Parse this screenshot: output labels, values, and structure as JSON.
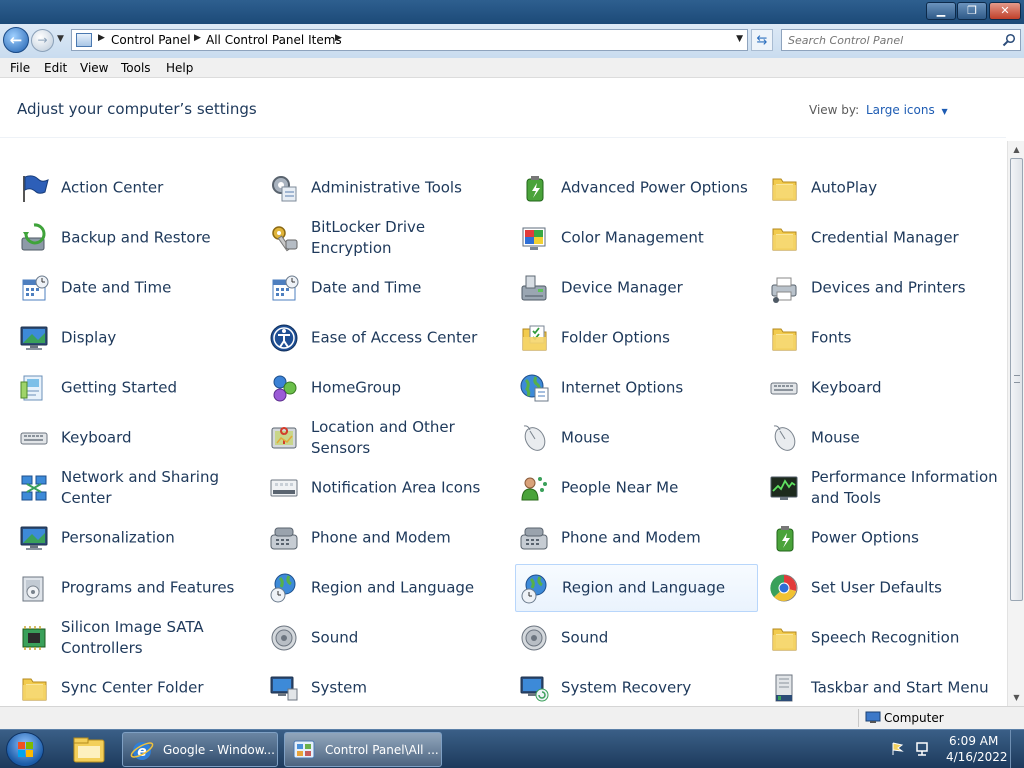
{
  "window": {
    "caption_buttons": {
      "minimize": "▁",
      "maximize": "❐",
      "close": "✕"
    }
  },
  "address_bar": {
    "breadcrumbs": [
      "Control Panel",
      "All Control Panel Items"
    ]
  },
  "search": {
    "placeholder": "Search Control Panel"
  },
  "menu": [
    "File",
    "Edit",
    "View",
    "Tools",
    "Help"
  ],
  "content": {
    "heading": "Adjust your computer’s settings",
    "view_by_label": "View by:",
    "view_by_value": "Large icons"
  },
  "items": [
    {
      "label": "Action Center",
      "icon": "flag-icon"
    },
    {
      "label": "Administrative Tools",
      "icon": "admin-tools-icon"
    },
    {
      "label": "Advanced Power Options",
      "icon": "battery-icon"
    },
    {
      "label": "AutoPlay",
      "icon": "folder-icon"
    },
    {
      "label": "Backup and Restore",
      "icon": "backup-icon"
    },
    {
      "label": "BitLocker Drive Encryption",
      "icon": "key-icon"
    },
    {
      "label": "Color Management",
      "icon": "color-icon"
    },
    {
      "label": "Credential Manager",
      "icon": "folder-icon"
    },
    {
      "label": "Date and Time",
      "icon": "calendar-icon"
    },
    {
      "label": "Date and Time",
      "icon": "calendar-icon"
    },
    {
      "label": "Device Manager",
      "icon": "device-manager-icon"
    },
    {
      "label": "Devices and Printers",
      "icon": "printer-icon"
    },
    {
      "label": "Display",
      "icon": "monitor-icon"
    },
    {
      "label": "Ease of Access Center",
      "icon": "accessibility-icon"
    },
    {
      "label": "Folder Options",
      "icon": "folder-options-icon"
    },
    {
      "label": "Fonts",
      "icon": "folder-icon"
    },
    {
      "label": "Getting Started",
      "icon": "getting-started-icon"
    },
    {
      "label": "HomeGroup",
      "icon": "homegroup-icon"
    },
    {
      "label": "Internet Options",
      "icon": "globe-icon"
    },
    {
      "label": "Keyboard",
      "icon": "keyboard-icon"
    },
    {
      "label": "Keyboard",
      "icon": "keyboard-icon"
    },
    {
      "label": "Location and Other Sensors",
      "icon": "location-icon"
    },
    {
      "label": "Mouse",
      "icon": "mouse-icon"
    },
    {
      "label": "Mouse",
      "icon": "mouse-icon"
    },
    {
      "label": "Network and Sharing Center",
      "icon": "network-icon"
    },
    {
      "label": "Notification Area Icons",
      "icon": "notification-icon"
    },
    {
      "label": "People Near Me",
      "icon": "people-icon"
    },
    {
      "label": "Performance Information and Tools",
      "icon": "performance-icon"
    },
    {
      "label": "Personalization",
      "icon": "monitor-icon"
    },
    {
      "label": "Phone and Modem",
      "icon": "phone-icon"
    },
    {
      "label": "Phone and Modem",
      "icon": "phone-icon"
    },
    {
      "label": "Power Options",
      "icon": "battery-icon"
    },
    {
      "label": "Programs and Features",
      "icon": "programs-icon"
    },
    {
      "label": "Region and Language",
      "icon": "globe-clock-icon"
    },
    {
      "label": "Region and Language",
      "icon": "globe-clock-icon"
    },
    {
      "label": "Set User Defaults",
      "icon": "defaults-icon"
    },
    {
      "label": "Silicon Image SATA Controllers",
      "icon": "chip-icon"
    },
    {
      "label": "Sound",
      "icon": "speaker-icon"
    },
    {
      "label": "Sound",
      "icon": "speaker-icon"
    },
    {
      "label": "Speech Recognition",
      "icon": "folder-icon"
    },
    {
      "label": "Sync Center Folder",
      "icon": "folder-icon"
    },
    {
      "label": "System",
      "icon": "system-icon"
    },
    {
      "label": "System Recovery",
      "icon": "system-recovery-icon"
    },
    {
      "label": "Taskbar and Start Menu",
      "icon": "taskbar-icon"
    }
  ],
  "status_bar": {
    "text": "Computer"
  },
  "taskbar": {
    "tasks": [
      {
        "label": "Google - Window...",
        "icon": "ie-icon",
        "active": false
      },
      {
        "label": "Control Panel\\All ...",
        "icon": "control-panel-icon",
        "active": true
      }
    ],
    "clock": {
      "time": "6:09 AM",
      "date": "4/16/2022"
    }
  },
  "colors": {
    "link_text": "#1e395b",
    "accent_link": "#1e5cb3",
    "hover_border": "#b8d6fb"
  }
}
